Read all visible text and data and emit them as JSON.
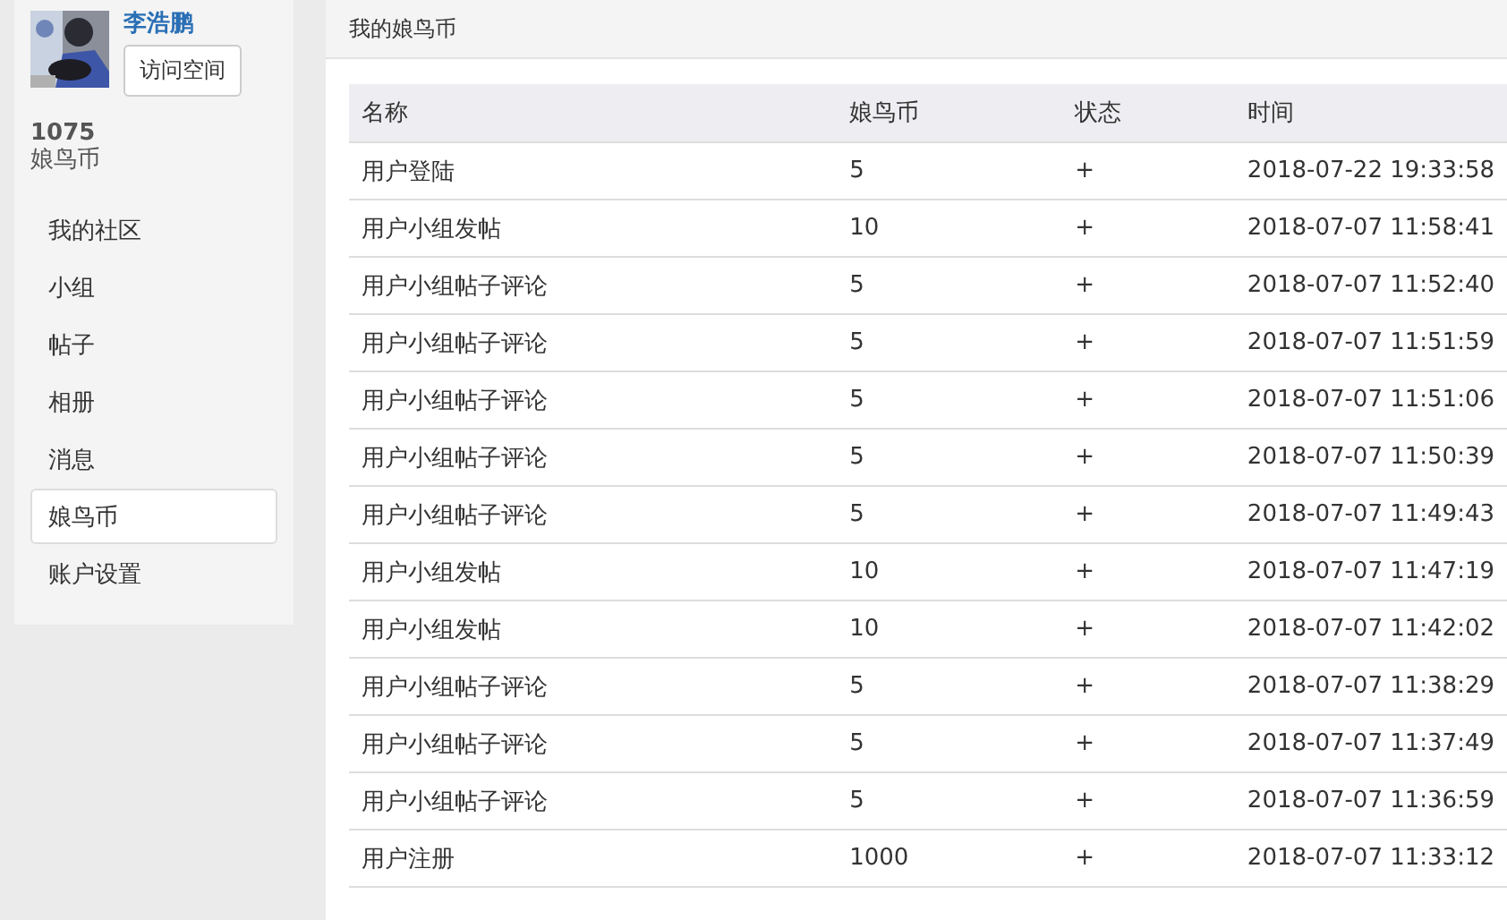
{
  "profile": {
    "kind": "picture",
    "name": "李浩鹏",
    "visit_button": "访问空间",
    "coins": "1075",
    "coins_label": "娘鸟币"
  },
  "sidebar": {
    "items": [
      {
        "label": "我的社区",
        "selected": false
      },
      {
        "label": "小组",
        "selected": false
      },
      {
        "label": "帖子",
        "selected": false
      },
      {
        "label": "相册",
        "selected": false
      },
      {
        "label": "消息",
        "selected": false
      },
      {
        "label": "娘鸟币",
        "selected": true
      },
      {
        "label": "账户设置",
        "selected": false
      }
    ]
  },
  "panel": {
    "title": "我的娘鸟币"
  },
  "table": {
    "columns": [
      "名称",
      "娘鸟币",
      "状态",
      "时间"
    ],
    "rows": [
      [
        "用户登陆",
        "5",
        "+",
        "2018-07-22 19:33:58"
      ],
      [
        "用户小组发帖",
        "10",
        "+",
        "2018-07-07 11:58:41"
      ],
      [
        "用户小组帖子评论",
        "5",
        "+",
        "2018-07-07 11:52:40"
      ],
      [
        "用户小组帖子评论",
        "5",
        "+",
        "2018-07-07 11:51:59"
      ],
      [
        "用户小组帖子评论",
        "5",
        "+",
        "2018-07-07 11:51:06"
      ],
      [
        "用户小组帖子评论",
        "5",
        "+",
        "2018-07-07 11:50:39"
      ],
      [
        "用户小组帖子评论",
        "5",
        "+",
        "2018-07-07 11:49:43"
      ],
      [
        "用户小组发帖",
        "10",
        "+",
        "2018-07-07 11:47:19"
      ],
      [
        "用户小组发帖",
        "10",
        "+",
        "2018-07-07 11:42:02"
      ],
      [
        "用户小组帖子评论",
        "5",
        "+",
        "2018-07-07 11:38:29"
      ],
      [
        "用户小组帖子评论",
        "5",
        "+",
        "2018-07-07 11:37:49"
      ],
      [
        "用户小组帖子评论",
        "5",
        "+",
        "2018-07-07 11:36:59"
      ],
      [
        "用户注册",
        "1000",
        "+",
        "2018-07-07 11:33:12"
      ]
    ]
  }
}
